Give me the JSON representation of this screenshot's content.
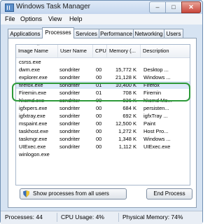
{
  "window": {
    "title": "Windows Task Manager",
    "min": "–",
    "max": "□",
    "close": "✕"
  },
  "menu": [
    "File",
    "Options",
    "View",
    "Help"
  ],
  "tabs": [
    "Applications",
    "Processes",
    "Services",
    "Performance",
    "Networking",
    "Users"
  ],
  "active_tab": "Processes",
  "columns": {
    "name": "Image Name",
    "user": "User Name",
    "cpu": "CPU",
    "mem": "Memory (...",
    "desc": "Description",
    "sort_indicator": "^"
  },
  "processes": [
    {
      "name": "csrss.exe",
      "user": "",
      "cpu": "",
      "mem": "",
      "desc": ""
    },
    {
      "name": "dwm.exe",
      "user": "sondriter",
      "cpu": "00",
      "mem": "15,772 K",
      "desc": "Desktop ..."
    },
    {
      "name": "explorer.exe",
      "user": "sondriter",
      "cpu": "00",
      "mem": "21,128 K",
      "desc": "Windows ..."
    },
    {
      "name": "firefox.exe",
      "user": "sondriter",
      "cpu": "01",
      "mem": "10,400 K",
      "desc": "Firefox"
    },
    {
      "name": "Firemin.exe",
      "user": "sondriter",
      "cpu": "01",
      "mem": "708 K",
      "desc": "Firemin"
    },
    {
      "name": "hkcmd.exe",
      "user": "sondriter",
      "cpu": "00",
      "mem": "836 K",
      "desc": "hkcmd Mo..."
    },
    {
      "name": "igfxpers.exe",
      "user": "sondriter",
      "cpu": "00",
      "mem": "684 K",
      "desc": "persisten..."
    },
    {
      "name": "igfxtray.exe",
      "user": "sondriter",
      "cpu": "00",
      "mem": "692 K",
      "desc": "igfxTray ..."
    },
    {
      "name": "mspaint.exe",
      "user": "sondriter",
      "cpu": "00",
      "mem": "12,500 K",
      "desc": "Paint"
    },
    {
      "name": "taskhost.exe",
      "user": "sondriter",
      "cpu": "00",
      "mem": "1,272 K",
      "desc": "Host Pro..."
    },
    {
      "name": "taskmgr.exe",
      "user": "sondriter",
      "cpu": "00",
      "mem": "1,348 K",
      "desc": "Windows ..."
    },
    {
      "name": "UIExec.exe",
      "user": "sondriter",
      "cpu": "00",
      "mem": "1,112 K",
      "desc": "UIExec.exe"
    },
    {
      "name": "winlogon.exe",
      "user": "",
      "cpu": "",
      "mem": "",
      "desc": ""
    }
  ],
  "selected_row": "firefox.exe",
  "buttons": {
    "show_all": "Show processes from all users",
    "end": "End Process"
  },
  "status": {
    "processes": "Processes: 44",
    "cpu": "CPU Usage: 4%",
    "memory": "Physical Memory: 74%"
  },
  "colors": {
    "highlight_ring": "#2e9a3a",
    "selected_row_bg": "#dbe8f8"
  }
}
